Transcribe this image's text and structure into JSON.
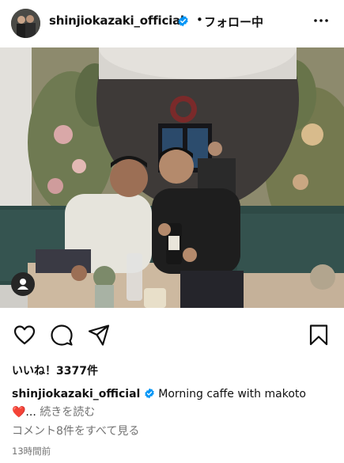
{
  "post": {
    "username": "shinjiokazaki_official",
    "separator": "•",
    "follow_status": "フォロー中",
    "likes": "いいね！3377件",
    "caption_text": "Morning caffe with makoto",
    "caption_line2": "❤️... ",
    "read_more": "続きを読む",
    "view_comments": "コメント8件をすべて見る",
    "time_ago": "13時間前"
  },
  "colors": {
    "verified": "#0095f6",
    "muted": "#737373"
  },
  "icons": [
    "verified-badge-icon",
    "more-options-icon",
    "user-tag-icon",
    "heart-icon",
    "comment-icon",
    "share-icon",
    "bookmark-icon"
  ]
}
